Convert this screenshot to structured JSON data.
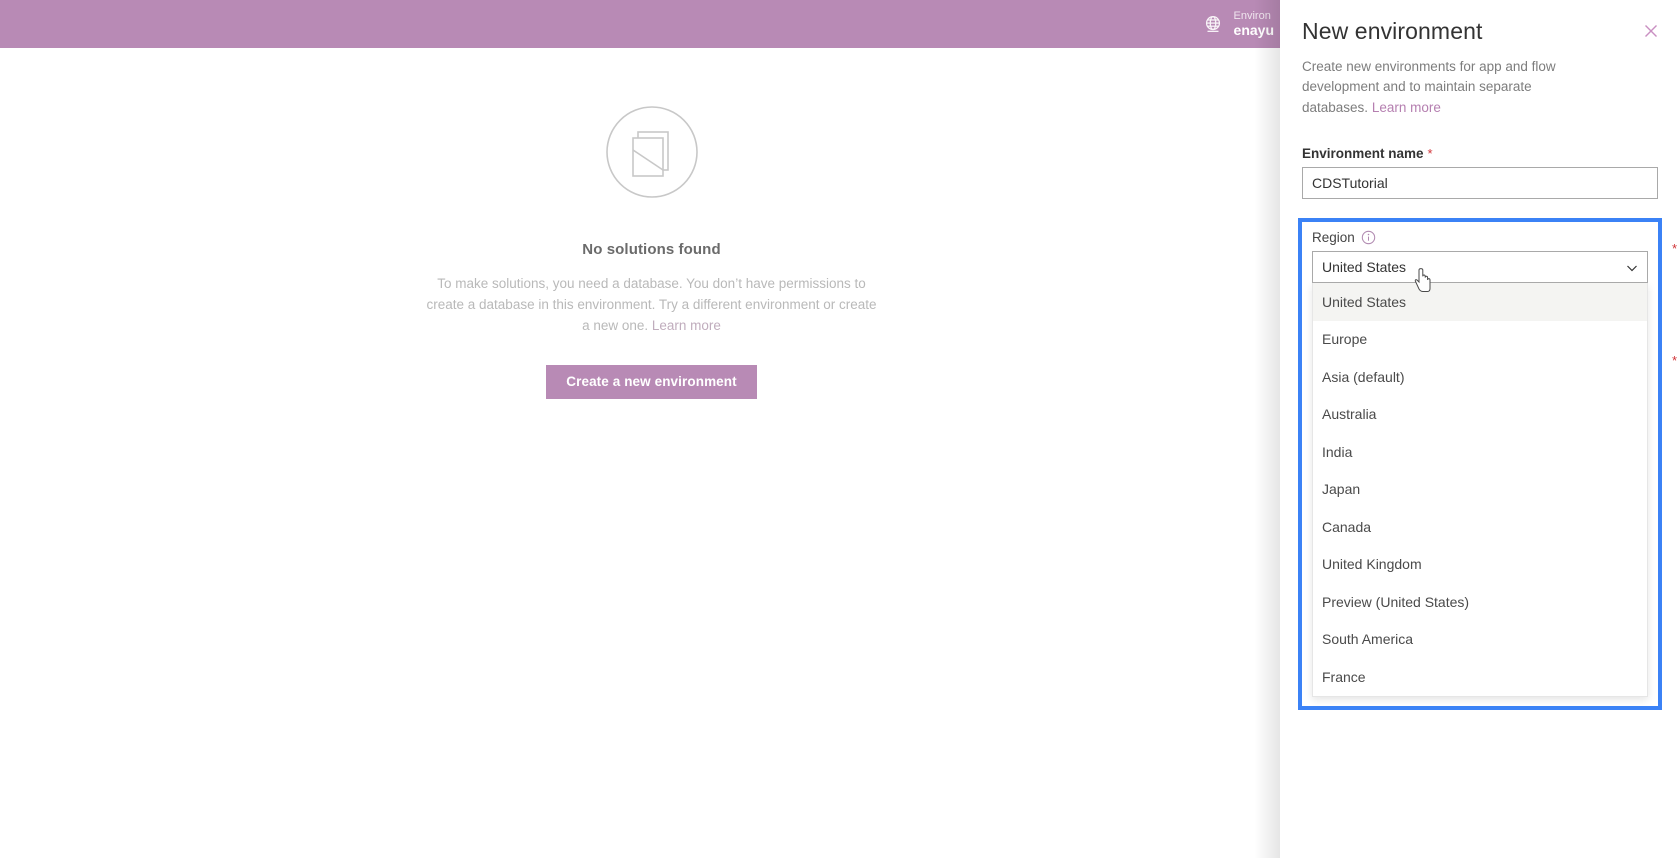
{
  "topbar": {
    "globe_icon": "globe-icon",
    "environment_label": "Environ",
    "environment_value": "enayu"
  },
  "main": {
    "empty_state": {
      "illustration_icon": "no-solutions-illustration-icon",
      "title": "No solutions found",
      "description": "To make solutions, you need a database. You don’t have permissions to create a database in this environment. Try a different environment or create a new one.",
      "learn_more": "Learn more",
      "cta_label": "Create a new environment"
    }
  },
  "panel": {
    "title": "New environment",
    "close_icon": "close-icon",
    "description": "Create new environments for app and flow development and to maintain separate databases.",
    "learn_more": "Learn more",
    "name_field": {
      "label": "Environment name",
      "required_mark": "*",
      "value": "CDSTutorial",
      "placeholder": "Environment name"
    },
    "region_field": {
      "label": "Region",
      "info_icon": "info-icon",
      "required_mark": "*",
      "selected": "United States",
      "caret_icon": "chevron-down-icon",
      "options": [
        "United States",
        "Europe",
        "Asia (default)",
        "Australia",
        "India",
        "Japan",
        "Canada",
        "United Kingdom",
        "Preview (United States)",
        "South America",
        "France"
      ]
    },
    "hidden_required_marks": [
      "*",
      "*"
    ]
  },
  "colors": {
    "brand_purple": "#b88ab5",
    "focus_blue": "#3b82f6",
    "required_red": "#d13438",
    "selected_option_bg": "#f4f4f2"
  },
  "cursor": {
    "icon": "pointing-hand-cursor-icon"
  }
}
